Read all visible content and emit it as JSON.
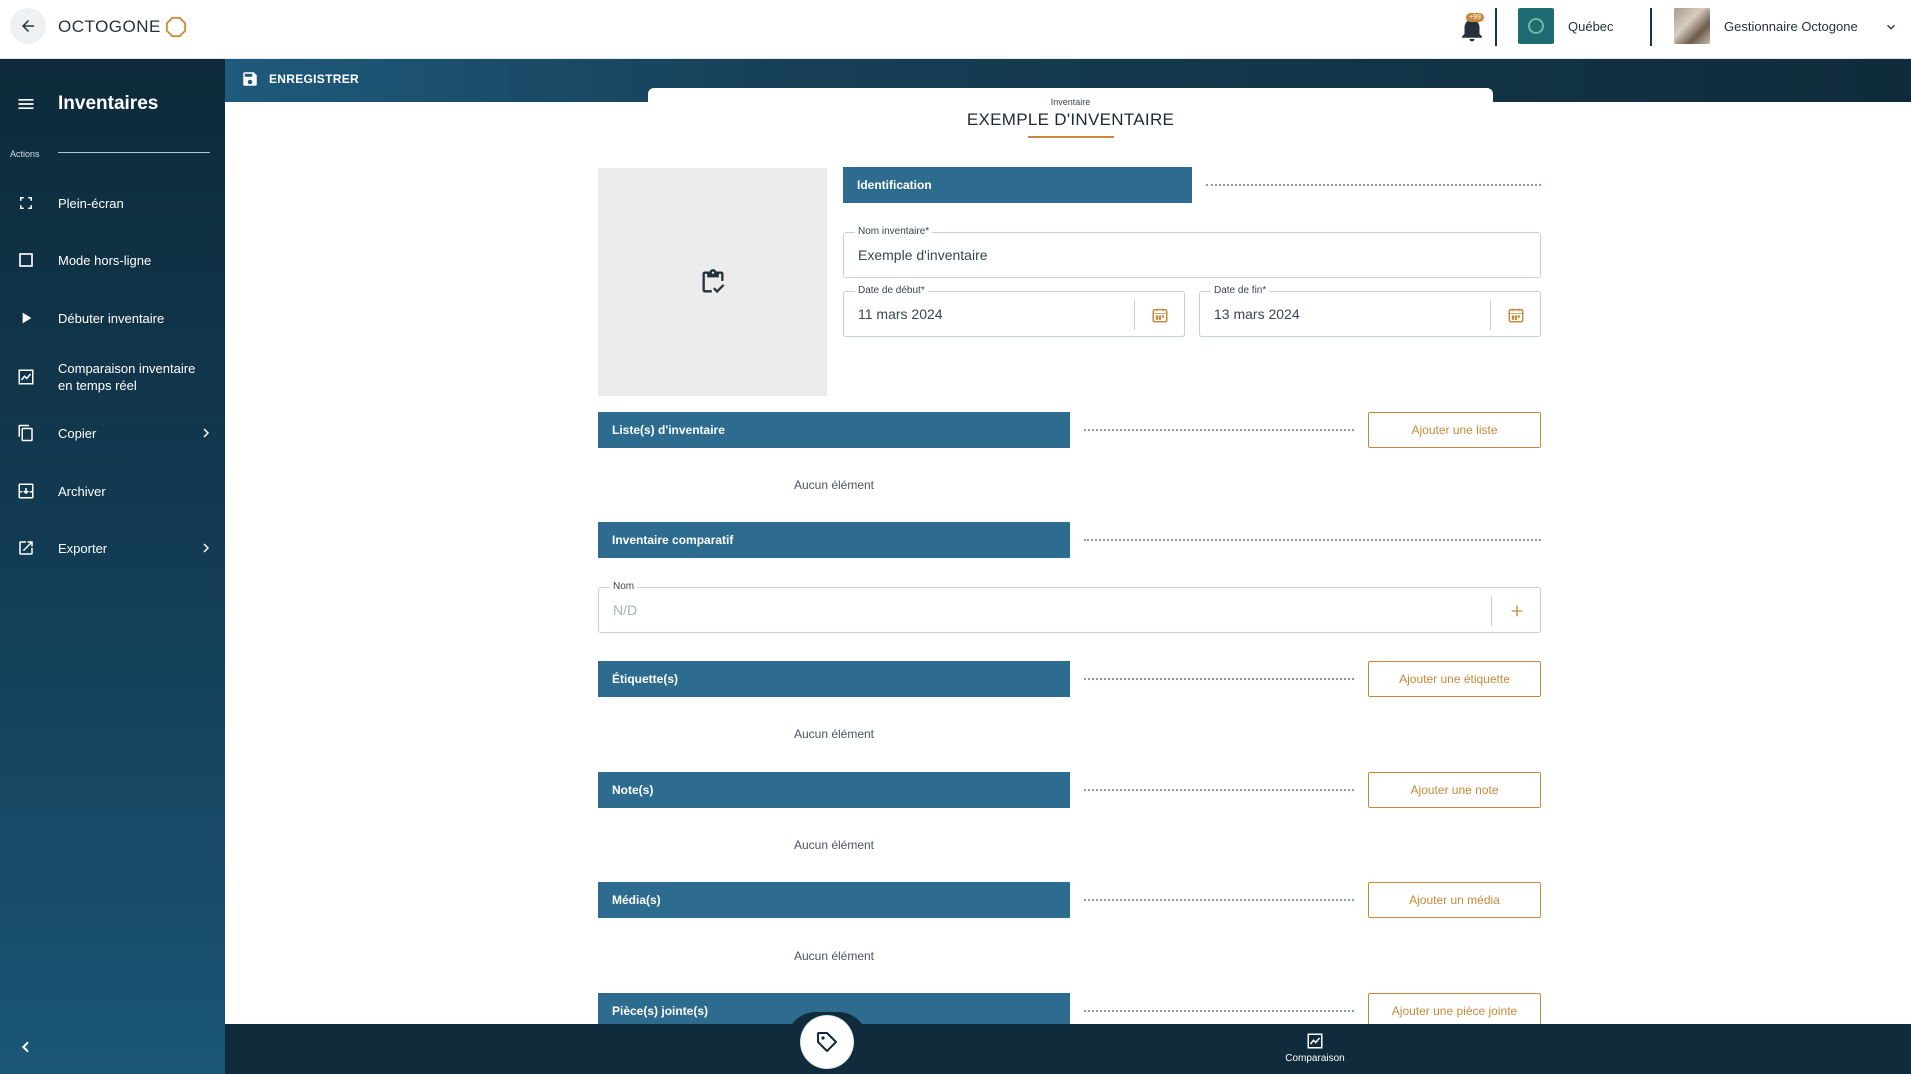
{
  "app": {
    "brand": "OCTOGONE",
    "notification_count": "+99",
    "organization": "Québec",
    "user": "Gestionnaire Octogone"
  },
  "sidebar": {
    "title": "Inventaires",
    "section_label": "Actions",
    "items": [
      {
        "label": "Plein-écran",
        "icon": "fullscreen-icon"
      },
      {
        "label": "Mode hors-ligne",
        "icon": "checkbox-icon"
      },
      {
        "label": "Débuter inventaire",
        "icon": "play-icon"
      },
      {
        "label": "Comparaison inventaire en temps réel",
        "icon": "chart-icon"
      },
      {
        "label": "Copier",
        "icon": "copy-icon",
        "has_submenu": true
      },
      {
        "label": "Archiver",
        "icon": "archive-icon"
      },
      {
        "label": "Exporter",
        "icon": "export-icon",
        "has_submenu": true
      }
    ]
  },
  "toolbar": {
    "save_label": "ENREGISTRER"
  },
  "header": {
    "subtitle": "Inventaire",
    "title": "EXEMPLE D'INVENTAIRE"
  },
  "identification": {
    "section_title": "Identification",
    "name_label": "Nom inventaire*",
    "name_value": "Exemple d'inventaire",
    "start_label": "Date de début*",
    "start_value": "11 mars 2024",
    "end_label": "Date de fin*",
    "end_value": "13 mars 2024"
  },
  "sections": {
    "lists": {
      "title": "Liste(s) d'inventaire",
      "button": "Ajouter une liste",
      "empty": "Aucun élément"
    },
    "comparative": {
      "title": "Inventaire comparatif",
      "field_label": "Nom",
      "field_placeholder": "N/D"
    },
    "labels": {
      "title": "Étiquette(s)",
      "button": "Ajouter une étiquette",
      "empty": "Aucun élément"
    },
    "notes": {
      "title": "Note(s)",
      "button": "Ajouter une note",
      "empty": "Aucun élément"
    },
    "media": {
      "title": "Média(s)",
      "button": "Ajouter un média",
      "empty": "Aucun élément"
    },
    "attachments": {
      "title": "Pièce(s) jointe(s)",
      "button": "Ajouter une pièce jointe"
    }
  },
  "bottom_bar": {
    "comparison_label": "Comparaison"
  },
  "colors": {
    "accent": "#c8893a",
    "section_header": "#2d6b8f",
    "sidebar_dark": "#0e2a3b"
  }
}
